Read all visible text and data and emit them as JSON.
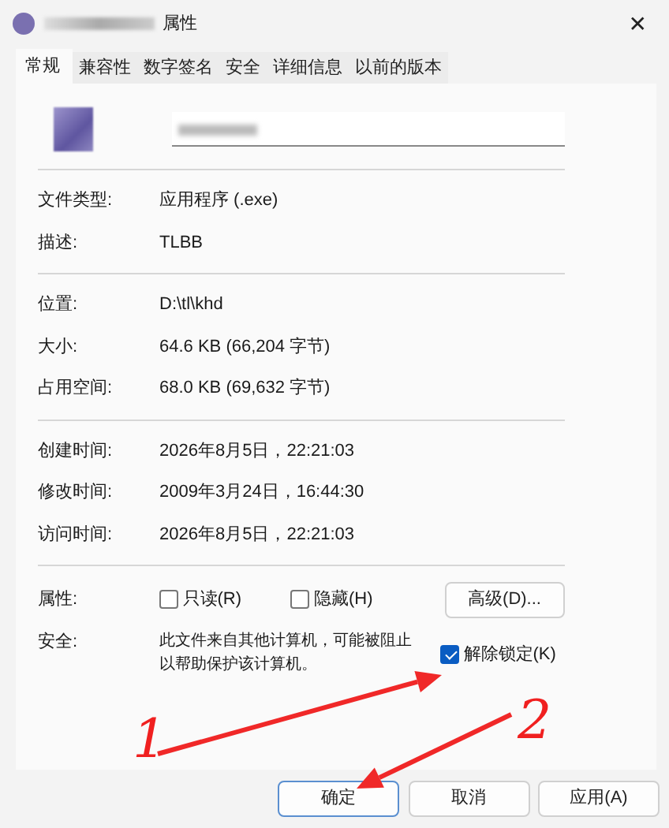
{
  "window": {
    "title": "属性",
    "close": "✕"
  },
  "tabs": [
    {
      "label": "常规",
      "selected": true
    },
    {
      "label": "兼容性",
      "selected": false
    },
    {
      "label": "数字签名",
      "selected": false
    },
    {
      "label": "安全",
      "selected": false
    },
    {
      "label": "详细信息",
      "selected": false
    },
    {
      "label": "以前的版本",
      "selected": false
    }
  ],
  "sections": [
    [
      {
        "label": "文件类型:",
        "value": "应用程序 (.exe)"
      },
      {
        "label": "描述:",
        "value": "TLBB"
      }
    ],
    [
      {
        "label": "位置:",
        "value": "D:\\tl\\khd"
      },
      {
        "label": "大小:",
        "value": "64.6 KB (66,204 字节)"
      },
      {
        "label": "占用空间:",
        "value": "68.0 KB (69,632 字节)"
      }
    ],
    [
      {
        "label": "创建时间:",
        "value": "2026年8月5日，22:21:03"
      },
      {
        "label": "修改时间:",
        "value": "2009年3月24日，16:44:30"
      },
      {
        "label": "访问时间:",
        "value": "2026年8月5日，22:21:03"
      }
    ]
  ],
  "attributes": {
    "label": "属性:",
    "options": [
      {
        "label": "只读(R)",
        "checked": false
      },
      {
        "label": "隐藏(H)",
        "checked": false
      }
    ],
    "advanced_button": "高级(D)..."
  },
  "security": {
    "label": "安全:",
    "text": "此文件来自其他计算机，可能被阻止以帮助保护该计算机。",
    "unblock": {
      "label": "解除锁定(K)",
      "checked": true
    }
  },
  "buttons": [
    {
      "label": "确定",
      "default": true
    },
    {
      "label": "取消",
      "default": false
    },
    {
      "label": "应用(A)",
      "default": false
    }
  ],
  "annotations": [
    {
      "label": "1"
    },
    {
      "label": "2"
    }
  ]
}
